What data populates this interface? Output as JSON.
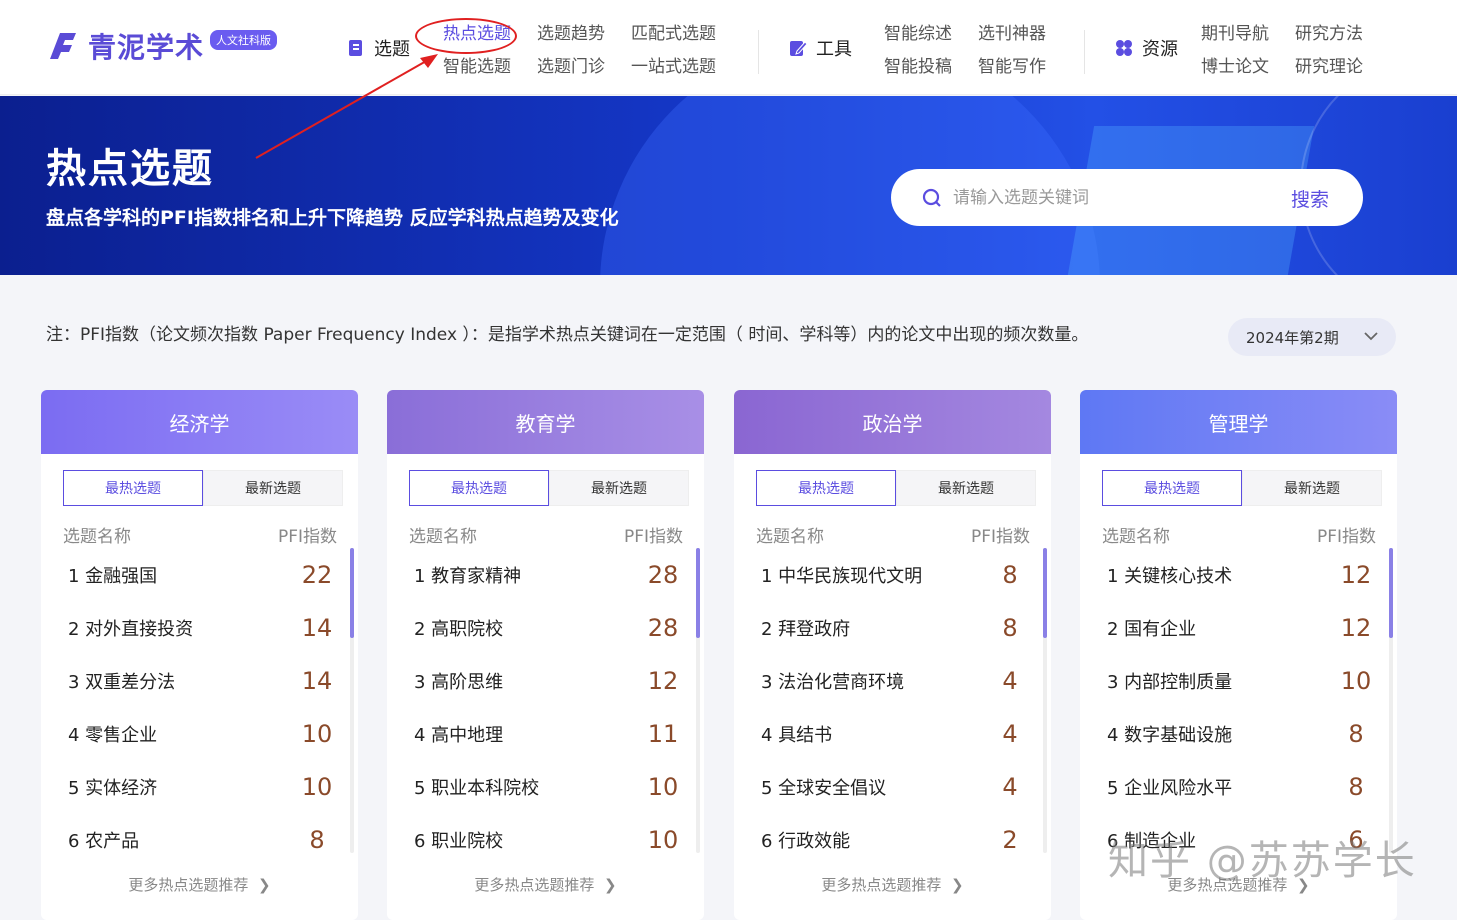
{
  "header": {
    "logo_text": "青泥学术",
    "logo_badge": "人文社科版",
    "groups": [
      {
        "category": "选题",
        "links": [
          "热点选题",
          "选题趋势",
          "匹配式选题",
          "智能选题",
          "选题门诊",
          "一站式选题"
        ]
      },
      {
        "category": "工具",
        "links": [
          "智能综述",
          "选刊神器",
          "智能投稿",
          "智能写作"
        ]
      },
      {
        "category": "资源",
        "links": [
          "期刊导航",
          "研究方法",
          "博士论文",
          "研究理论"
        ]
      }
    ]
  },
  "banner": {
    "title": "热点选题",
    "subtitle": "盘点各学科的PFI指数排名和上升下降趋势 反应学科热点趋势及变化",
    "search_placeholder": "请输入选题关键词",
    "search_button": "搜索"
  },
  "note": "注：PFI指数（论文频次指数 Paper Frequency Index ）：是指学术热点关键词在一定范围（ 时间、学科等）内的论文中出现的频次数量。",
  "period": "2024年第2期",
  "tab_hot": "最热选题",
  "tab_new": "最新选题",
  "col_name": "选题名称",
  "col_pfi": "PFI指数",
  "more_label": "更多热点选题推荐",
  "cards": [
    {
      "title": "经济学",
      "color_from": "#7b6cf2",
      "color_to": "#9a8cf6",
      "rows": [
        [
          "1 金融强国",
          "22"
        ],
        [
          "2 对外直接投资",
          "14"
        ],
        [
          "3 双重差分法",
          "14"
        ],
        [
          "4 零售企业",
          "10"
        ],
        [
          "5 实体经济",
          "10"
        ],
        [
          "6 农产品",
          "8"
        ]
      ]
    },
    {
      "title": "教育学",
      "color_from": "#8a6ed8",
      "color_to": "#a88fe6",
      "rows": [
        [
          "1 教育家精神",
          "28"
        ],
        [
          "2 高职院校",
          "28"
        ],
        [
          "3 高阶思维",
          "12"
        ],
        [
          "4 高中地理",
          "11"
        ],
        [
          "5 职业本科院校",
          "10"
        ],
        [
          "6 职业院校",
          "10"
        ]
      ]
    },
    {
      "title": "政治学",
      "color_from": "#8a66d2",
      "color_to": "#a488e0",
      "rows": [
        [
          "1 中华民族现代文明",
          "8"
        ],
        [
          "2 拜登政府",
          "8"
        ],
        [
          "3 法治化营商环境",
          "4"
        ],
        [
          "4 具结书",
          "4"
        ],
        [
          "5 全球安全倡议",
          "4"
        ],
        [
          "6 行政效能",
          "2"
        ]
      ]
    },
    {
      "title": "管理学",
      "color_from": "#5e78f4",
      "color_to": "#8a8cf6",
      "rows": [
        [
          "1 关键核心技术",
          "12"
        ],
        [
          "2 国有企业",
          "12"
        ],
        [
          "3 内部控制质量",
          "10"
        ],
        [
          "4 数字基础设施",
          "8"
        ],
        [
          "5 企业风险水平",
          "8"
        ],
        [
          "6 制造企业",
          "6"
        ]
      ]
    }
  ],
  "watermark": "知乎 @苏苏学长"
}
